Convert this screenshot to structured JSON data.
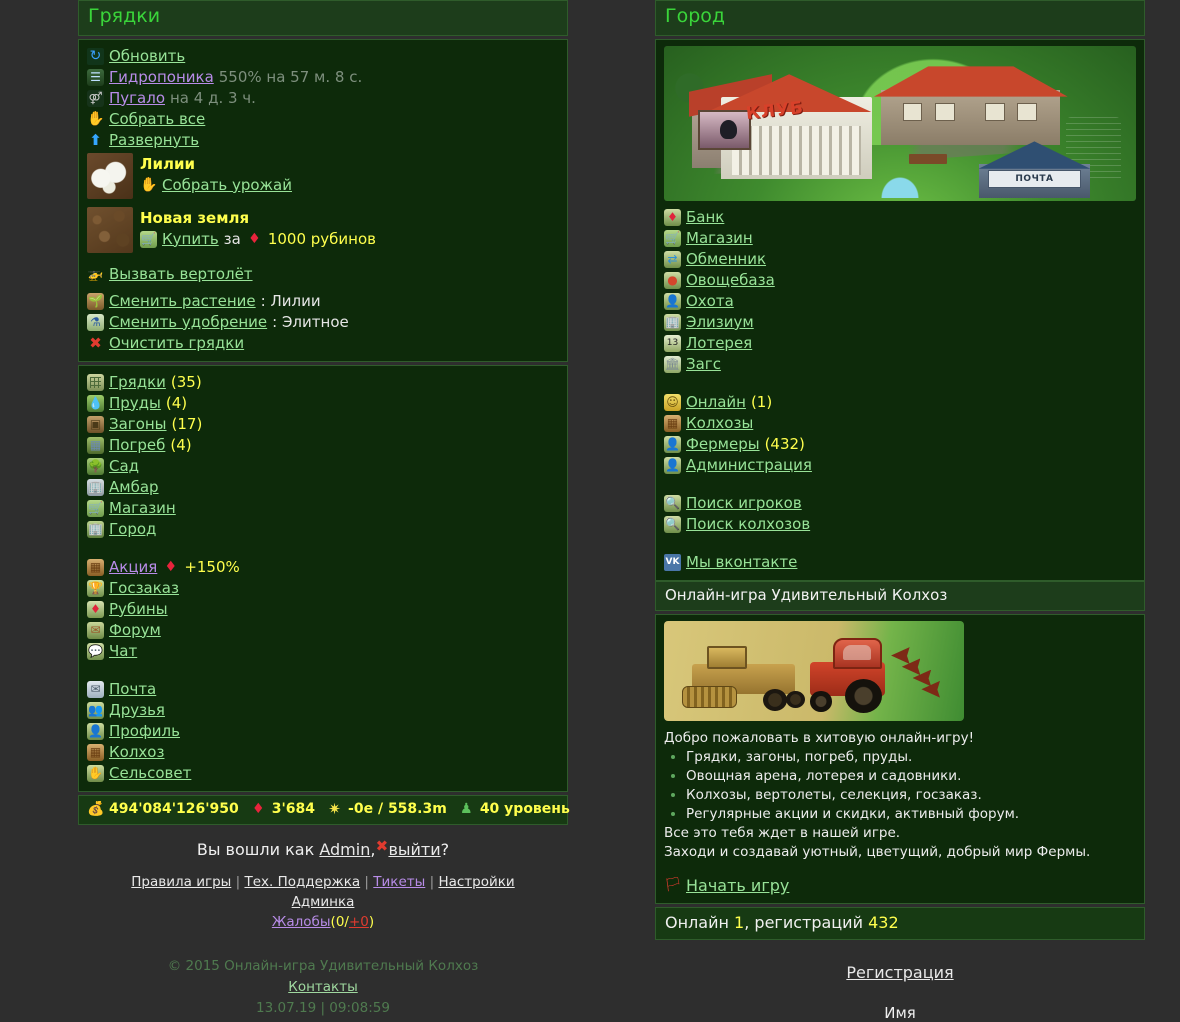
{
  "left_panel": {
    "title": "Грядки",
    "actions": [
      {
        "icon": "refresh-icon",
        "label": "Обновить",
        "link_style": "normal",
        "suffix": ""
      },
      {
        "icon": "hydroponics-icon",
        "label": "Гидропоника",
        "link_style": "visited",
        "suffix": "550% на 57 м. 8 с."
      },
      {
        "icon": "scarecrow-icon",
        "label": "Пугало",
        "link_style": "visited",
        "suffix": "на 4 д. 3 ч."
      },
      {
        "icon": "hand-icon",
        "label": "Собрать все",
        "link_style": "normal",
        "suffix": ""
      },
      {
        "icon": "up-arrow-icon",
        "label": "Развернуть",
        "link_style": "normal",
        "suffix": ""
      }
    ],
    "plot": {
      "thumb": "lily-plot-thumb",
      "name": "Лилии",
      "harvest_icon": "hand-icon",
      "harvest_label": "Собрать урожай"
    },
    "new_land": {
      "thumb": "soil-plot-thumb",
      "name": "Новая земля",
      "buy_icon": "cart-icon",
      "buy_label": "Купить",
      "mid_text": "за",
      "price_icon": "ruby-icon",
      "price": "1000 рубинов"
    },
    "tools": [
      {
        "icon": "helicopter-icon",
        "label": "Вызвать вертолёт",
        "value": ""
      },
      {
        "icon": "pot-icon",
        "label": "Сменить растение",
        "value": ": Лилии"
      },
      {
        "icon": "flask-icon",
        "label": "Сменить удобрение",
        "value": ": Элитное"
      },
      {
        "icon": "red-cross-icon",
        "label": "Очистить грядки",
        "value": ""
      }
    ],
    "nav": [
      {
        "icon": "beds-icon",
        "label": "Грядки",
        "count": "(35)"
      },
      {
        "icon": "pond-icon",
        "label": "Пруды",
        "count": "(4)"
      },
      {
        "icon": "pen-icon",
        "label": "Загоны",
        "count": "(17)"
      },
      {
        "icon": "cellar-icon",
        "label": "Погреб",
        "count": "(4)"
      },
      {
        "icon": "tree-icon",
        "label": "Сад",
        "count": ""
      },
      {
        "icon": "barn-icon",
        "label": "Амбар",
        "count": ""
      },
      {
        "icon": "cart-icon",
        "label": "Магазин",
        "count": ""
      },
      {
        "icon": "city-icon",
        "label": "Город",
        "count": ""
      }
    ],
    "promo": {
      "icon": "promo-icon",
      "label": "Акция",
      "bonus_icon": "ruby-icon",
      "bonus": "+150%"
    },
    "nav2": [
      {
        "icon": "cup-icon",
        "label": "Госзаказ"
      },
      {
        "icon": "ruby-icon",
        "label": "Рубины"
      },
      {
        "icon": "forum-icon",
        "label": "Форум"
      },
      {
        "icon": "chat-icon",
        "label": "Чат"
      }
    ],
    "nav3": [
      {
        "icon": "mail-icon",
        "label": "Почта"
      },
      {
        "icon": "friends-icon",
        "label": "Друзья"
      },
      {
        "icon": "profile-icon",
        "label": "Профиль"
      },
      {
        "icon": "kolhoz-icon",
        "label": "Колхоз"
      },
      {
        "icon": "council-icon",
        "label": "Сельсовет"
      }
    ],
    "stats": {
      "money_icon": "money-icon",
      "money": "494'084'126'950",
      "ruby_icon": "ruby-icon",
      "rubies": "3'684",
      "star_icon": "star-icon",
      "exp": "-0e / 558.3m",
      "level_icon": "level-icon",
      "level": "40 уровень"
    }
  },
  "footer": {
    "login_prefix": "Вы вошли как",
    "login_user": "Admin",
    "login_comma": ",",
    "logout_icon": "red-cross-icon",
    "logout": "выйти",
    "login_suffix": "?",
    "links": [
      "Правила игры",
      "Тех. Поддержка",
      "Тикеты",
      "Настройки"
    ],
    "separator": "|",
    "admin_link": "Админка",
    "complaints_label": "Жалобы",
    "complaints_open": "(0/",
    "complaints_new": "+0",
    "complaints_close": ")",
    "copyright": "© 2015 Онлайн-игра Удивительный Колхоз",
    "contacts": "Контакты",
    "datetime": "13.07.19 | 09:08:59"
  },
  "right_panel": {
    "title": "Город",
    "banner": {
      "club_sign": "КЛУБ",
      "post_sign": "ПОЧТА"
    },
    "city_links": [
      {
        "icon": "bank-icon",
        "label": "Банк",
        "count": ""
      },
      {
        "icon": "shop-icon",
        "label": "Магазин",
        "count": ""
      },
      {
        "icon": "exchange-icon",
        "label": "Обменник",
        "count": ""
      },
      {
        "icon": "vegetable-icon",
        "label": "Овощебаза",
        "count": ""
      },
      {
        "icon": "hunt-icon",
        "label": "Охота",
        "count": ""
      },
      {
        "icon": "elysium-icon",
        "label": "Элизиум",
        "count": ""
      },
      {
        "icon": "lottery-icon",
        "label": "Лотерея",
        "count": ""
      },
      {
        "icon": "zags-icon",
        "label": "Загс",
        "count": ""
      }
    ],
    "community_links": [
      {
        "icon": "online-icon",
        "label": "Онлайн",
        "count": "(1)"
      },
      {
        "icon": "kolhoz-icon",
        "label": "Колхозы",
        "count": ""
      },
      {
        "icon": "farmer-icon",
        "label": "Фермеры",
        "count": "(432)"
      },
      {
        "icon": "admin-icon",
        "label": "Администрация",
        "count": ""
      }
    ],
    "search_links": [
      {
        "icon": "search-icon",
        "label": "Поиск игроков"
      },
      {
        "icon": "search-icon",
        "label": "Поиск колхозов"
      }
    ],
    "social": {
      "icon": "vk-icon",
      "icon_text": "VK",
      "label": "Мы вконтакте"
    }
  },
  "promo_panel": {
    "title": "Онлайн-игра Удивительный Колхоз",
    "welcome_heading": "Добро пожаловать в хитовую онлайн-игру!",
    "features": [
      "Грядки, загоны, погреб, пруды.",
      "Овощная арена, лотерея и садовники.",
      "Колхозы, вертолеты, селекция, госзаказ.",
      "Регулярные акции и скидки, активный форум."
    ],
    "outro_1": "Все это тебя ждет в нашей игре.",
    "outro_2": "Заходи и создавай уютный, цветущий, добрый мир Фермы.",
    "start_icon": "flag-icon",
    "start_label": "Начать игру",
    "online_prefix": "Онлайн",
    "online_count": "1",
    "online_mid": ", регистраций",
    "registered_count": "432",
    "register_link": "Регистрация",
    "name_label": "Имя"
  }
}
